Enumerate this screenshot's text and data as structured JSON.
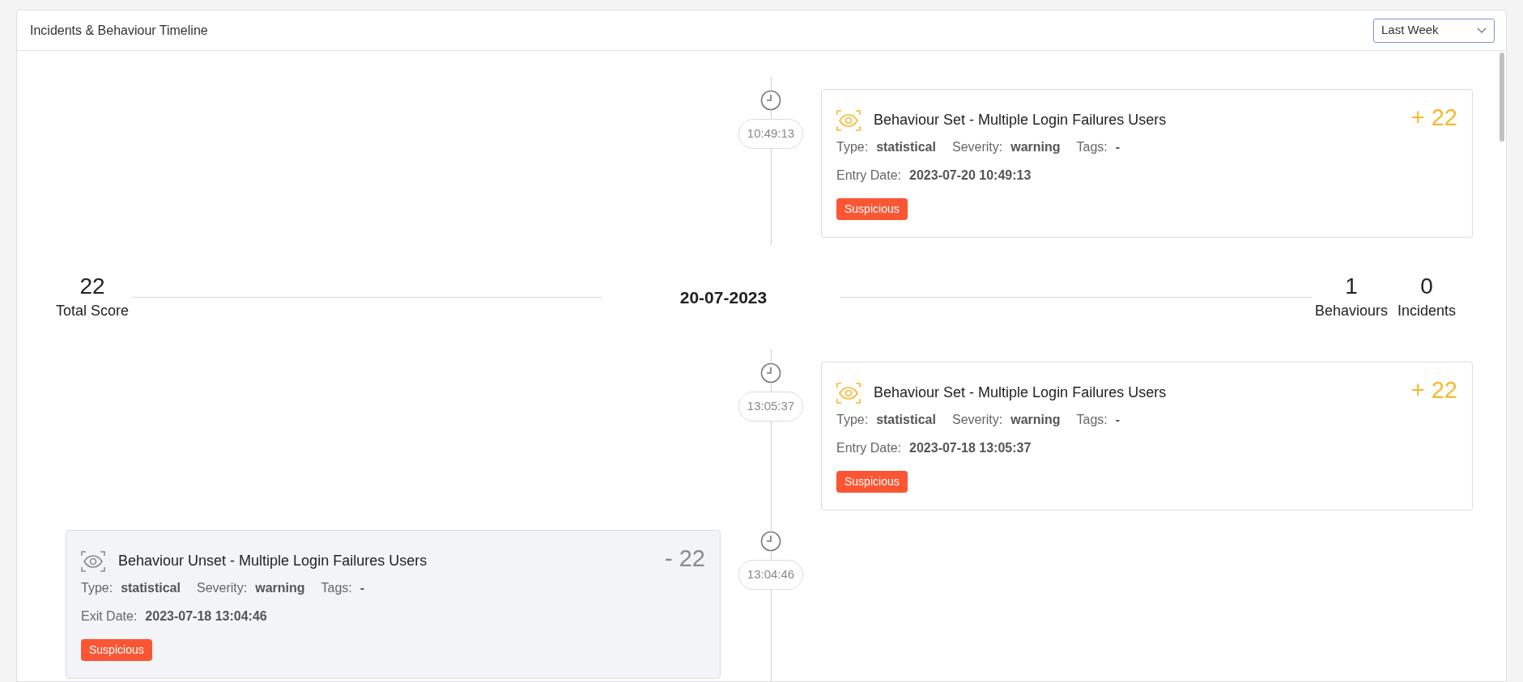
{
  "panel": {
    "title": "Incidents & Behaviour Timeline",
    "range_select": {
      "value": "Last Week"
    }
  },
  "timeline": [
    {
      "kind": "set",
      "time": "10:49:13",
      "title": "Behaviour Set - Multiple Login Failures Users",
      "score": "+ 22",
      "type_label": "Type:",
      "type": "statistical",
      "severity_label": "Severity:",
      "severity": "warning",
      "tags_label": "Tags:",
      "tags": "-",
      "date_label": "Entry Date:",
      "date": "2023-07-20 10:49:13",
      "badge": "Suspicious"
    },
    {
      "kind": "day_summary",
      "total_score": "22",
      "total_score_label": "Total Score",
      "date": "20-07-2023",
      "behaviours": "1",
      "behaviours_label": "Behaviours",
      "incidents": "0",
      "incidents_label": "Incidents"
    },
    {
      "kind": "set",
      "time": "13:05:37",
      "title": "Behaviour Set - Multiple Login Failures Users",
      "score": "+ 22",
      "type_label": "Type:",
      "type": "statistical",
      "severity_label": "Severity:",
      "severity": "warning",
      "tags_label": "Tags:",
      "tags": "-",
      "date_label": "Entry Date:",
      "date": "2023-07-18 13:05:37",
      "badge": "Suspicious"
    },
    {
      "kind": "unset",
      "time": "13:04:46",
      "title": "Behaviour Unset - Multiple Login Failures Users",
      "score": "- 22",
      "type_label": "Type:",
      "type": "statistical",
      "severity_label": "Severity:",
      "severity": "warning",
      "tags_label": "Tags:",
      "tags": "-",
      "date_label": "Exit Date:",
      "date": "2023-07-18 13:04:46",
      "badge": "Suspicious"
    }
  ]
}
